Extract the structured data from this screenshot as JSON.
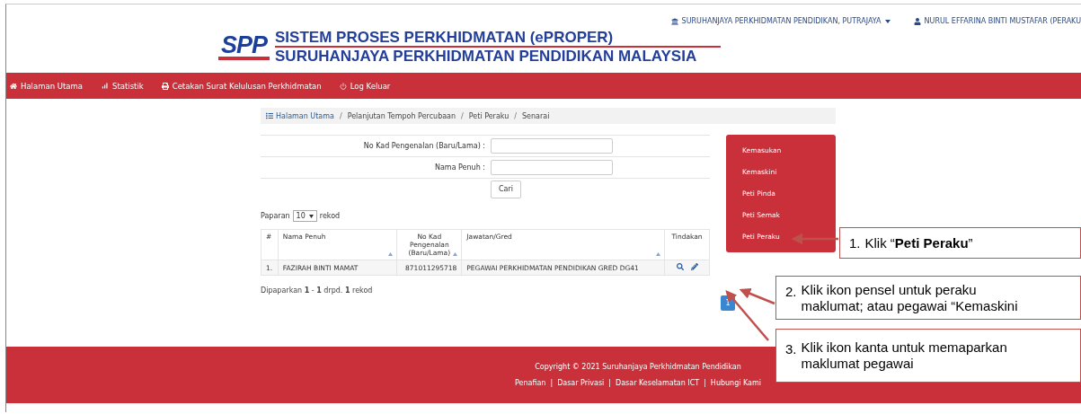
{
  "topbar": {
    "institution": "SURUHANJAYA PERKHIDMATAN PENDIDIKAN, PUTRAJAYA",
    "user": "NURUL EFFARINA BINTI MUSTAFAR (PERAKU"
  },
  "logo": {
    "mark": "SPP",
    "line_1": "SISTEM PROSES PERKHIDMATAN (ePROPER)",
    "line_2": "SURUHANJAYA PERKHIDMATAN PENDIDIKAN MALAYSIA"
  },
  "nav": [
    {
      "label": "Halaman Utama"
    },
    {
      "label": "Statistik"
    },
    {
      "label": "Cetakan Surat Kelulusan Perkhidmatan"
    },
    {
      "label": "Log Keluar"
    }
  ],
  "breadcrumb": {
    "separator": "/",
    "items": [
      {
        "label": "Halaman Utama",
        "link": true
      },
      {
        "label": "Pelanjutan Tempoh Percubaan",
        "link": false
      },
      {
        "label": "Peti Peraku",
        "link": false
      },
      {
        "label": "Senarai",
        "link": false
      }
    ]
  },
  "form": {
    "fields": [
      {
        "label": "No Kad Pengenalan (Baru/Lama) :"
      },
      {
        "label": "Nama Penuh :"
      }
    ],
    "button": "Cari"
  },
  "page_size": {
    "before": "Paparan",
    "value": "10",
    "after": "rekod"
  },
  "table": {
    "columns": [
      {
        "label": "#",
        "sortable": false
      },
      {
        "label": "Nama Penuh",
        "sortable": true
      },
      {
        "label": "No Kad Pengenalan (Baru/Lama)",
        "sortable": true
      },
      {
        "label": "Jawatan/Gred",
        "sortable": true
      },
      {
        "label": "Tindakan",
        "sortable": false
      }
    ],
    "rows": [
      {
        "cells": [
          "1.",
          "FAZIRAH BINTI MAMAT",
          "871011295718",
          "PEGAWAI PERKHIDMATAN PENDIDIKAN GRED DG41"
        ]
      }
    ]
  },
  "summary": "Dipaparkan **1** - **1** drpd. **1** rekod",
  "pagination": [
    {
      "label": "1",
      "selected": true
    }
  ],
  "side_menu": [
    {
      "label": "Kemasukan"
    },
    {
      "label": "Kemaskini"
    },
    {
      "label": "Peti Pinda"
    },
    {
      "label": "Peti Semak"
    },
    {
      "label": "Peti Peraku"
    }
  ],
  "footer": {
    "copyright": "Copyright © 2021 Suruhanjaya Perkhidmatan Pendidikan",
    "separator": "|",
    "links": [
      "Penafian",
      "Dasar Privasi",
      "Dasar Keselamatan ICT",
      "Hubungi Kami"
    ]
  },
  "callouts": [
    {
      "number": "1.",
      "text": "Klik “**Peti Peraku**”"
    },
    {
      "number": "2.",
      "text": "Klik ikon pensel untuk peraku maklumat; atau pegawai “Kemaskini"
    },
    {
      "number": "3.",
      "text": "Klik ikon kanta untuk memaparkan maklumat pegawai"
    }
  ]
}
